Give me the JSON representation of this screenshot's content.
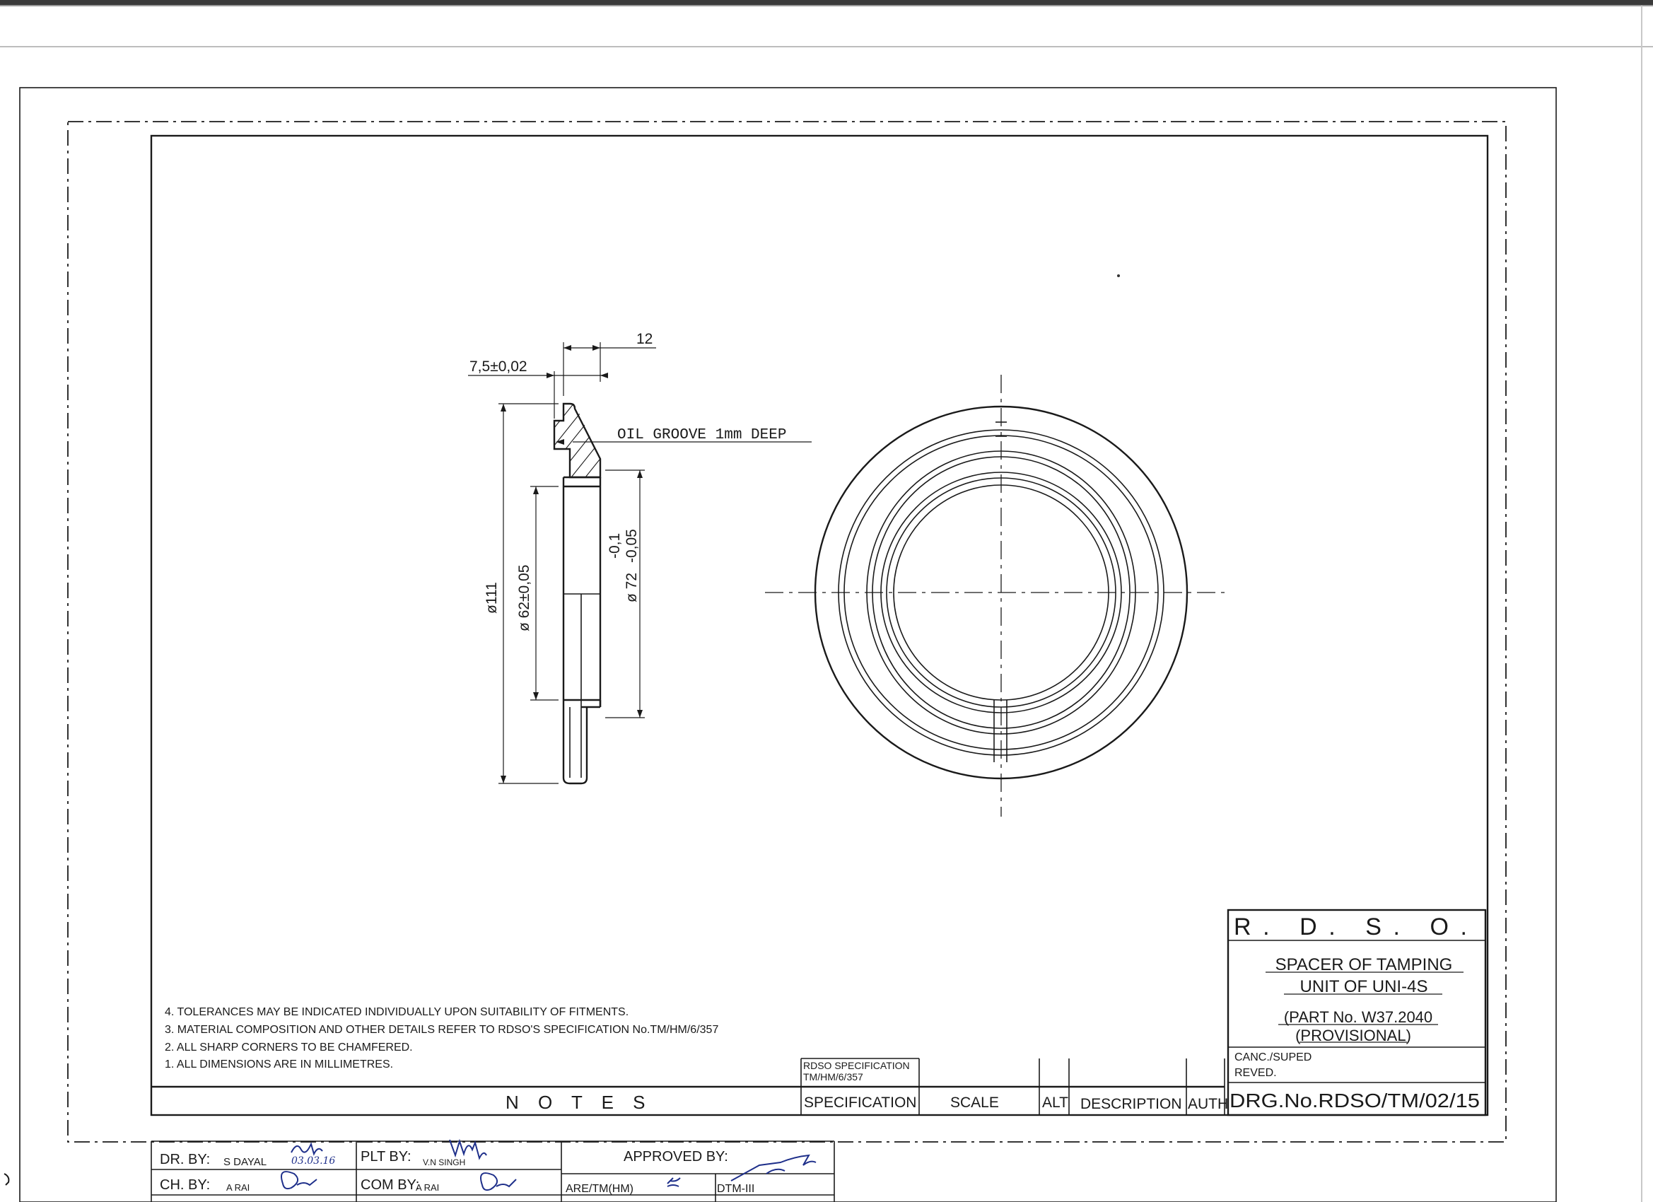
{
  "dimensions": {
    "width_7_5": "7,5±0,02",
    "width_12": "12",
    "dia_111": "ø111",
    "dia_62": "ø 62±0,05",
    "dia_72": "ø 72",
    "dia_72_tol_lower": "-0,05",
    "dia_72_tol_upper": "-0,1",
    "oil_groove": "OIL GROOVE 1mm DEEP"
  },
  "notes": {
    "items": [
      "4. TOLERANCES MAY BE INDICATED INDIVIDUALLY UPON SUITABILITY OF FITMENTS.",
      "3. MATERIAL COMPOSITION AND OTHER DETAILS REFER TO RDSO'S SPECIFICATION No.TM/HM/6/357",
      "2. ALL SHARP CORNERS TO BE CHAMFERED.",
      "1. ALL DIMENSIONS ARE IN MILLIMETRES."
    ],
    "label": "N O T E S"
  },
  "title_block": {
    "org": "R.  D.  S.  O.",
    "title_line1": "SPACER OF TAMPING",
    "title_line2": "UNIT OF UNI-4S",
    "part_no": "(PART No. W37.2040",
    "provisional": "(PROVISIONAL)",
    "canc_suped": "CANC./SUPED",
    "reved": "REVED.",
    "drawing_no": "DRG.No.RDSO/TM/02/15"
  },
  "bottom_strip": {
    "rdso_spec_line1": "RDSO SPECIFICATION",
    "rdso_spec_line2": "TM/HM/6/357",
    "specification": "SPECIFICATION",
    "scale": "SCALE",
    "alt": "ALT",
    "description": "DESCRIPTION",
    "auth": "AUTH"
  },
  "signatures": {
    "dr_by_label": "DR. BY:",
    "dr_by_name": "S DAYAL",
    "dr_by_date": "03.03.16",
    "plt_by_label": "PLT BY:",
    "plt_by_name": "V.N SINGH",
    "approved_by_label": "APPROVED BY:",
    "ch_by_label": "CH. BY:",
    "ch_by_name": "A RAI",
    "com_by_label": "COM BY:",
    "com_by_name": "A RAI",
    "are_label": "ARE/TM(HM)",
    "dtm_label": "DTM-III"
  },
  "colors": {
    "ink": "#1a1a1a",
    "signature_ink": "#1e2f8a",
    "paper": "#ffffff"
  }
}
